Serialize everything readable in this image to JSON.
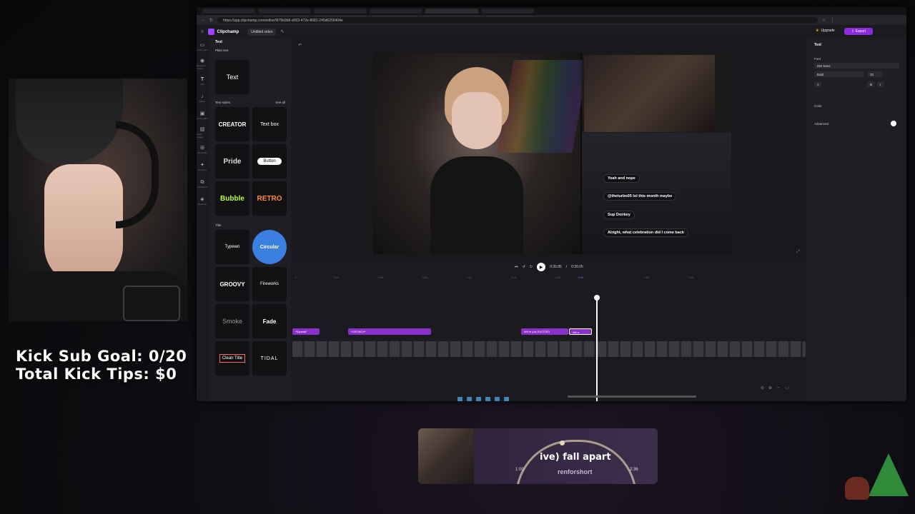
{
  "overlay": {
    "kick_sub_goal": "Kick Sub Goal: 0/20",
    "kick_tips": "Total Kick Tips: $0"
  },
  "browser": {
    "tabs": [
      "",
      "",
      "",
      "",
      "",
      ""
    ],
    "address": "https://app.clipchamp.com/editor/9f75b9b6-d063-472e-8681-245d6256404e"
  },
  "app": {
    "name": "Clipchamp",
    "project_title": "Untitled video",
    "upgrade_label": "Upgrade",
    "export_label": "Export",
    "rail": [
      {
        "icon": "folder-icon",
        "label": "Your media"
      },
      {
        "icon": "record-icon",
        "label": "Record & create"
      },
      {
        "icon": "text-icon",
        "label": "Text"
      },
      {
        "icon": "music-icon",
        "label": "Music"
      },
      {
        "icon": "stock-video-icon",
        "label": "Stock video"
      },
      {
        "icon": "stock-images-icon",
        "label": "Stock images"
      },
      {
        "icon": "templates-icon",
        "label": "Templates"
      },
      {
        "icon": "graphics-icon",
        "label": "Graphics"
      },
      {
        "icon": "transitions-icon",
        "label": "Transitions"
      },
      {
        "icon": "brand-kit-icon",
        "label": "Brand kit"
      }
    ],
    "panel": {
      "title": "Text",
      "plain_text_label": "Plain text",
      "plain_text_tile": "Text",
      "text_styles_label": "Text styles",
      "see_all": "See all",
      "styles": [
        "CREATOR",
        "Text box",
        "Pride",
        "Button",
        "Bubble",
        "RETRO"
      ],
      "title_label": "Title",
      "titles": [
        "Typewri",
        "Circular",
        "GROOVY",
        "Fireworks",
        "Smoke",
        "Fade",
        "Clean Title",
        "TIDAL"
      ]
    },
    "preview": {
      "chat": [
        {
          "text": "Yeah and nope"
        },
        {
          "text": "@theturbo05 lol this month maybe"
        },
        {
          "text": "Sup Donkey"
        },
        {
          "text": "Alright, what celebration did I come back"
        }
      ]
    },
    "timeline": {
      "current_time": "0:30.85",
      "total_time": "0:39.05",
      "ruler_ticks": [
        "0",
        "0:03",
        "0:06",
        "0:09",
        "0:12",
        "0:15",
        "0:18",
        "0:21",
        "0:24",
        "0:27",
        "0:30",
        "0:33",
        "0:36"
      ],
      "text_clips": [
        "*Squeak*",
        "*CRONCH*",
        "We're just EXCITED",
        "We a"
      ]
    },
    "properties": {
      "header": "Text",
      "font_label": "Font",
      "font_value": "DM Sans",
      "weight_value": "Bold",
      "size_value": "32",
      "color_label": "Color",
      "advanced_label": "Advanced"
    }
  },
  "music": {
    "song": "ive)    fall apart",
    "artist": "renforshort",
    "current": "1:00",
    "duration": "2:36"
  }
}
